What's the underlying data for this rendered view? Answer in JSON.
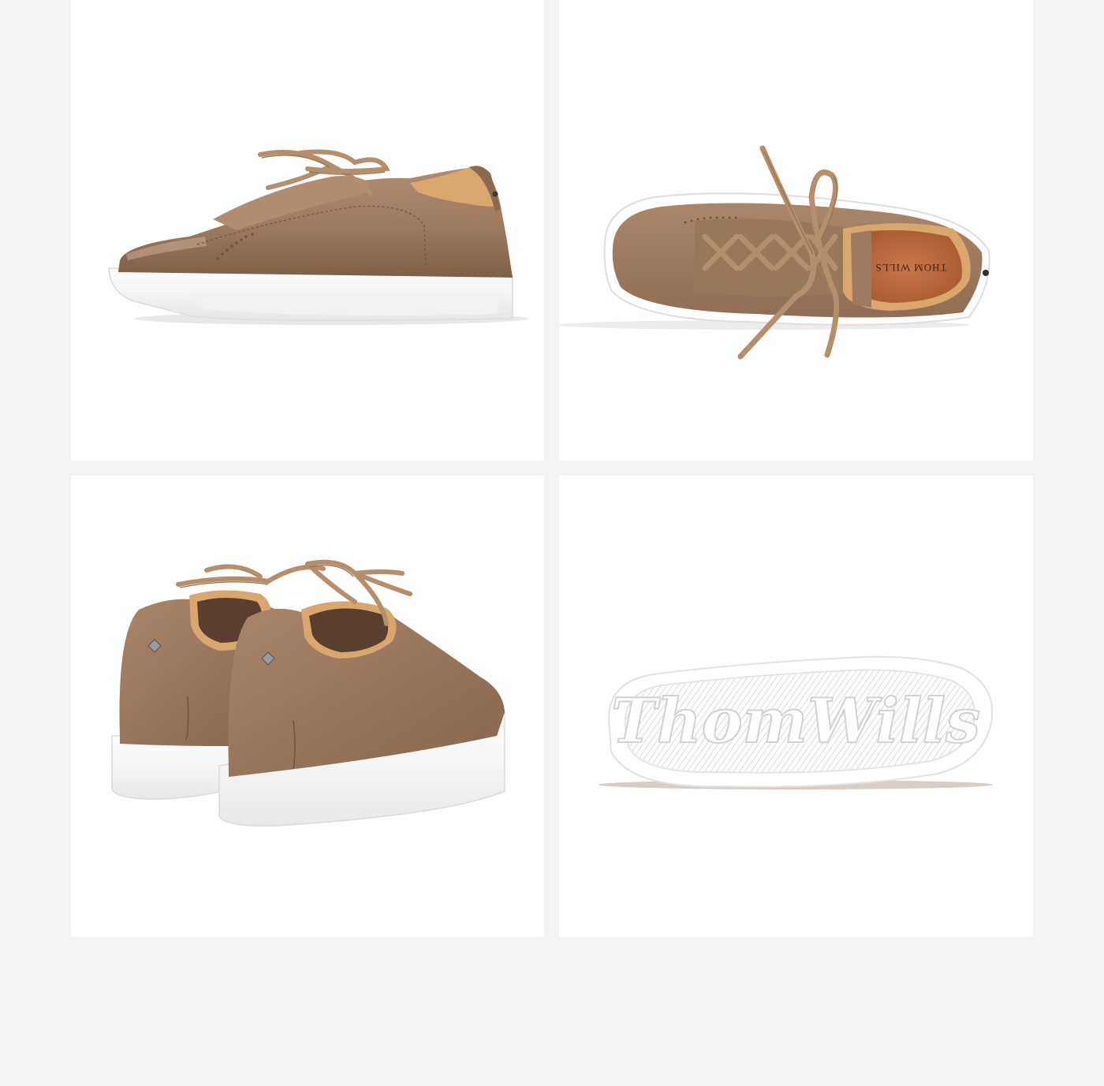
{
  "gallery": {
    "colors": {
      "page_background": "#f3f3f3",
      "panel_background": "#ffffff",
      "leather": "#9c7a5e",
      "leather_shadow": "#7d5f47",
      "leather_light": "#b69378",
      "lining": "#d9a66e",
      "insole": "#c2703f",
      "lace": "#b58f6b",
      "sole": "#ffffff",
      "sole_edge": "#e3e3e3"
    },
    "panels": [
      {
        "view": "side",
        "image": "sneaker-side-view"
      },
      {
        "view": "top",
        "image": "sneaker-top-view",
        "insole_brand": "THOM WILLS"
      },
      {
        "view": "back",
        "image": "sneaker-pair-back-view"
      },
      {
        "view": "sole",
        "image": "sneaker-outsole-view",
        "sole_brand": "ThomWills"
      }
    ]
  }
}
